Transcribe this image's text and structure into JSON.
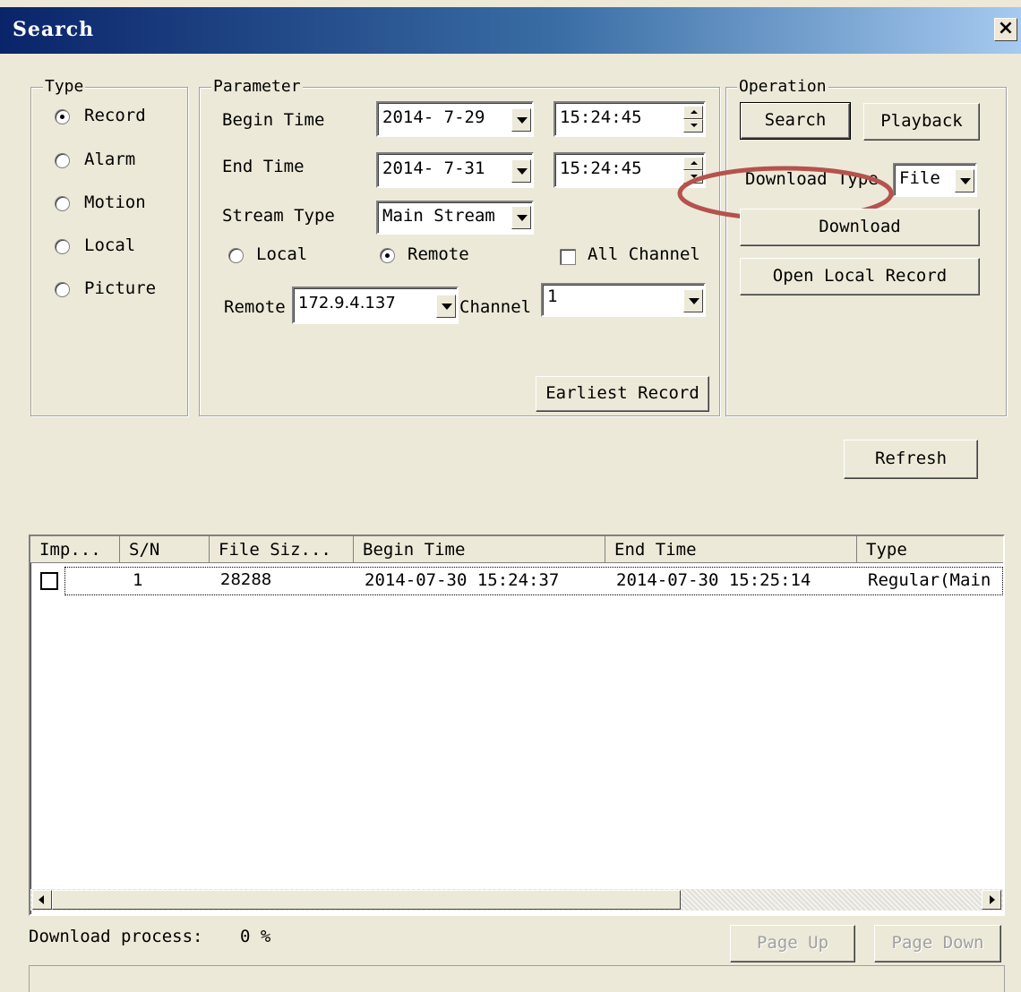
{
  "window": {
    "title": "Search",
    "close_icon": "close-icon"
  },
  "type_group": {
    "legend": "Type",
    "options": [
      {
        "label": "Record",
        "selected": true
      },
      {
        "label": "Alarm",
        "selected": false
      },
      {
        "label": "Motion",
        "selected": false
      },
      {
        "label": "Local",
        "selected": false
      },
      {
        "label": "Picture",
        "selected": false
      }
    ]
  },
  "parameter_group": {
    "legend": "Parameter",
    "begin_time_label": "Begin Time",
    "begin_date": "2014- 7-29",
    "begin_time": "15:24:45",
    "end_time_label": "End Time",
    "end_date": "2014- 7-31",
    "end_time": "15:24:45",
    "stream_type_label": "Stream Type",
    "stream_type_value": "Main Stream",
    "local_label": "Local",
    "local_selected": false,
    "remote_label": "Remote",
    "remote_selected": true,
    "all_channel_label": "All Channel",
    "all_channel_checked": false,
    "remote_select_label": "Remote",
    "remote_select_value": "172.9.4.137",
    "channel_label": "Channel",
    "channel_value": "1",
    "earliest_record_button": "Earliest Record"
  },
  "operation_group": {
    "legend": "Operation",
    "search_button": "Search",
    "playback_button": "Playback",
    "download_type_label": "Download Type",
    "download_type_value": "File",
    "download_button": "Download",
    "open_local_record_button": "Open Local Record",
    "annotation_color": "#B5524E"
  },
  "refresh_button": "Refresh",
  "table": {
    "columns": [
      "Imp...",
      "S/N",
      "File Siz...",
      "Begin Time",
      "End Time",
      "Type"
    ],
    "rows": [
      {
        "checked": false,
        "sn": "1",
        "file_size": "28288",
        "begin_time": "2014-07-30 15:24:37",
        "end_time": "2014-07-30 15:25:14",
        "type": "Regular(Main"
      }
    ]
  },
  "status": {
    "download_process_label": "Download process:",
    "download_process_value": "0 %"
  },
  "page_up_button": "Page Up",
  "page_down_button": "Page Down",
  "colors": {
    "titlebar_start": "#0A246A",
    "titlebar_end": "#A6CAF0",
    "dialog_bg": "#ECE9D8"
  }
}
